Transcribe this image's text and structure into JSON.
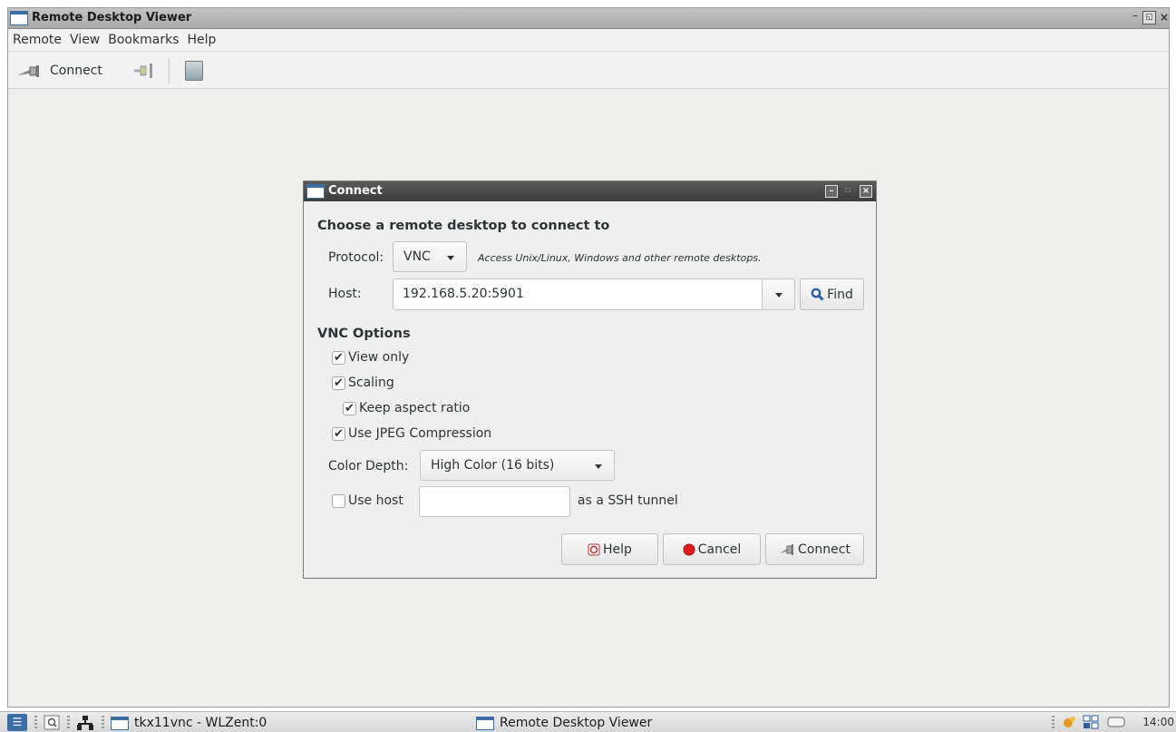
{
  "window": {
    "title": "Remote Desktop Viewer",
    "controls": {
      "minimize": "–",
      "maximize": "◱",
      "close": "×"
    }
  },
  "menubar": {
    "items": [
      "Remote",
      "View",
      "Bookmarks",
      "Help"
    ]
  },
  "toolbar": {
    "connect_label": "Connect"
  },
  "dialog": {
    "title": "Connect",
    "heading": "Choose a remote desktop to connect to",
    "protocol": {
      "label": "Protocol:",
      "value": "VNC",
      "hint": "Access Unix/Linux, Windows and other remote desktops."
    },
    "host": {
      "label": "Host:",
      "value": "192.168.5.20:5901",
      "find_label": "Find"
    },
    "vnc_options": {
      "heading": "VNC Options",
      "view_only": {
        "label": "View only",
        "checked": true
      },
      "scaling": {
        "label": "Scaling",
        "checked": true
      },
      "keep_aspect": {
        "label": "Keep aspect ratio",
        "checked": true
      },
      "jpeg": {
        "label": "Use JPEG Compression",
        "checked": true
      },
      "color_depth": {
        "label": "Color Depth:",
        "value": "High Color (16 bits)"
      },
      "ssh": {
        "label": "Use host",
        "suffix": "as a SSH tunnel",
        "checked": false,
        "value": ""
      }
    },
    "buttons": {
      "help": "Help",
      "cancel": "Cancel",
      "connect": "Connect"
    }
  },
  "taskbar": {
    "tasks": [
      "tkx11vnc - WLZent:0",
      "Remote Desktop Viewer"
    ],
    "clock": "14:00"
  },
  "colors": {
    "title_dark": "#3c3c3c",
    "cancel_red": "#e01b1b",
    "find_blue": "#2a5fa8"
  }
}
